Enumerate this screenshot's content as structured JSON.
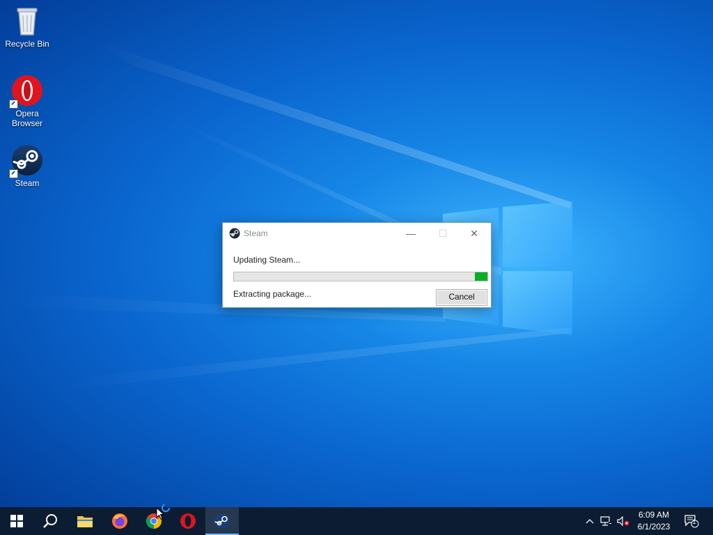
{
  "desktop": {
    "icons": [
      {
        "label": "Recycle Bin",
        "icon": "recycle-bin-icon"
      },
      {
        "label": "Opera Browser",
        "icon": "opera-icon"
      },
      {
        "label": "Steam",
        "icon": "steam-icon"
      }
    ]
  },
  "dialog": {
    "title": "Steam",
    "status": "Updating Steam...",
    "substatus": "Extracting package...",
    "progress_fraction": 0.05,
    "progress_color": "#06b025",
    "cancel_label": "Cancel"
  },
  "taskbar": {
    "apps": [
      "start-icon",
      "search-icon",
      "file-explorer-icon",
      "firefox-icon",
      "chrome-icon",
      "opera-icon",
      "steam-icon"
    ],
    "active_app": "steam-icon",
    "clock": {
      "time": "6:09 AM",
      "date": "6/1/2023"
    },
    "notification_count": "1"
  },
  "colors": {
    "accent": "#0a66cf",
    "taskbar": "#0c1d33"
  }
}
